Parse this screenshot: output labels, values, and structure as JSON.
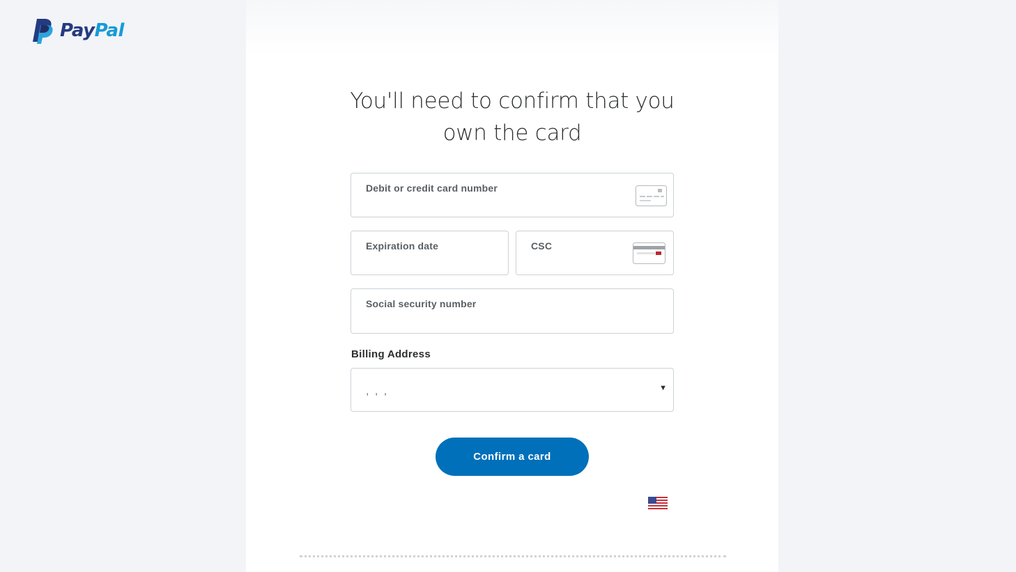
{
  "brand": {
    "icon": "paypal-p-icon",
    "name_part1": "Pay",
    "name_part2": "Pal",
    "colors": {
      "dark_blue": "#253b80",
      "light_blue": "#179bd7"
    }
  },
  "page": {
    "heading_line1": "You'll need to confirm that you",
    "heading_line2": "own the card"
  },
  "form": {
    "card_number_label": "Debit or credit card number",
    "card_icon": "credit-card-icon",
    "expiration_label": "Expiration date",
    "csc_label": "CSC",
    "csc_icon": "card-back-icon",
    "ssn_label": "Social security number",
    "billing_address_label": "Billing Address",
    "billing_address_value": ", , ,",
    "dropdown_icon": "dropdown-arrow-icon",
    "confirm_button_label": "Confirm a card",
    "country_flag_icon": "us-flag-icon"
  },
  "colors": {
    "primary_button": "#0070ba",
    "page_background": "#f2f4f8",
    "field_border": "#cbd2d6"
  }
}
